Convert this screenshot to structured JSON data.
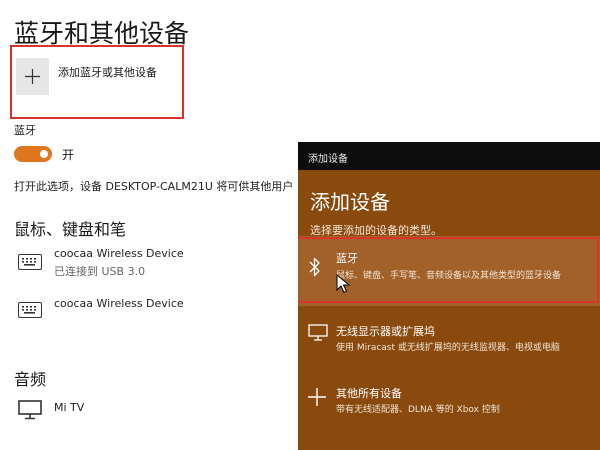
{
  "settings": {
    "title": "蓝牙和其他设备",
    "add_device_label": "添加蓝牙或其他设备",
    "bluetooth_heading": "蓝牙",
    "bluetooth_toggle_state": "开",
    "discoverable_text": "打开此选项，设备 DESKTOP-CALM21U 将可供其他用户",
    "mouse_section_heading": "鼠标、键盘和笔",
    "devices": [
      {
        "name": "coocaa Wireless Device",
        "status": "已连接到 USB 3.0",
        "icon": "keyboard-icon"
      },
      {
        "name": "coocaa Wireless Device",
        "status": "",
        "icon": "keyboard-icon"
      }
    ],
    "audio_section_heading": "音频",
    "audio_devices": [
      {
        "name": "Mi TV",
        "icon": "monitor-icon"
      }
    ]
  },
  "dialog": {
    "titlebar": "添加设备",
    "heading": "添加设备",
    "subtitle": "选择要添加的设备的类型。",
    "options": [
      {
        "title": "蓝牙",
        "description": "鼠标、键盘、手写笔、音频设备以及其他类型的蓝牙设备",
        "icon": "bluetooth-icon",
        "selected": true
      },
      {
        "title": "无线显示器或扩展坞",
        "description": "使用 Miracast 或无线扩展坞的无线监视器、电视或电脑",
        "icon": "monitor-icon",
        "selected": false
      },
      {
        "title": "其他所有设备",
        "description": "带有无线适配器、DLNA 等的 Xbox 控制",
        "icon": "plus-icon",
        "selected": false
      }
    ]
  },
  "colors": {
    "accent": "#e0761e",
    "dialog_bg": "#8b4a0d",
    "dialog_selected": "#a3612a",
    "highlight_box": "#d9342b"
  }
}
